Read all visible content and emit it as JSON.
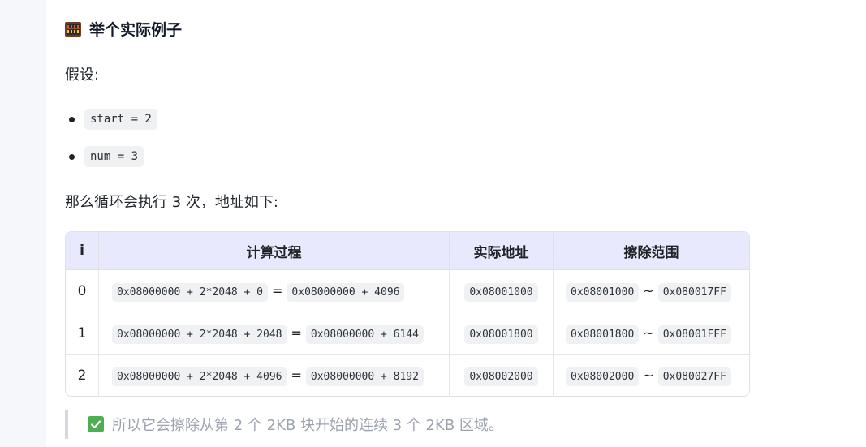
{
  "heading": {
    "title": "举个实际例子",
    "icon": "abacus-icon"
  },
  "assume_label": "假设:",
  "bullets": [
    {
      "code": "start = 2"
    },
    {
      "code": "num = 3"
    }
  ],
  "loop_text": "那么循环会执行 3 次，地址如下:",
  "table": {
    "headers": [
      "i",
      "计算过程",
      "实际地址",
      "擦除范围"
    ],
    "rows": [
      {
        "i": "0",
        "calc_left": "0x08000000 + 2*2048 + 0",
        "calc_eq": "=",
        "calc_right": "0x08000000 + 4096",
        "addr": "0x08001000",
        "range_start": "0x08001000",
        "range_sep": "~",
        "range_end": "0x080017FF"
      },
      {
        "i": "1",
        "calc_left": "0x08000000 + 2*2048 + 2048",
        "calc_eq": "=",
        "calc_right": "0x08000000 + 6144",
        "addr": "0x08001800",
        "range_start": "0x08001800",
        "range_sep": "~",
        "range_end": "0x08001FFF"
      },
      {
        "i": "2",
        "calc_left": "0x08000000 + 2*2048 + 4096",
        "calc_eq": "=",
        "calc_right": "0x08000000 + 8192",
        "addr": "0x08002000",
        "range_start": "0x08002000",
        "range_sep": "~",
        "range_end": "0x080027FF"
      }
    ],
    "header_bg": "#e8e9fc"
  },
  "quote": {
    "icon": "check-mark-icon",
    "text": "所以它会擦除从第 2 个 2KB 块开始的连续 3 个 2KB 区域。"
  }
}
